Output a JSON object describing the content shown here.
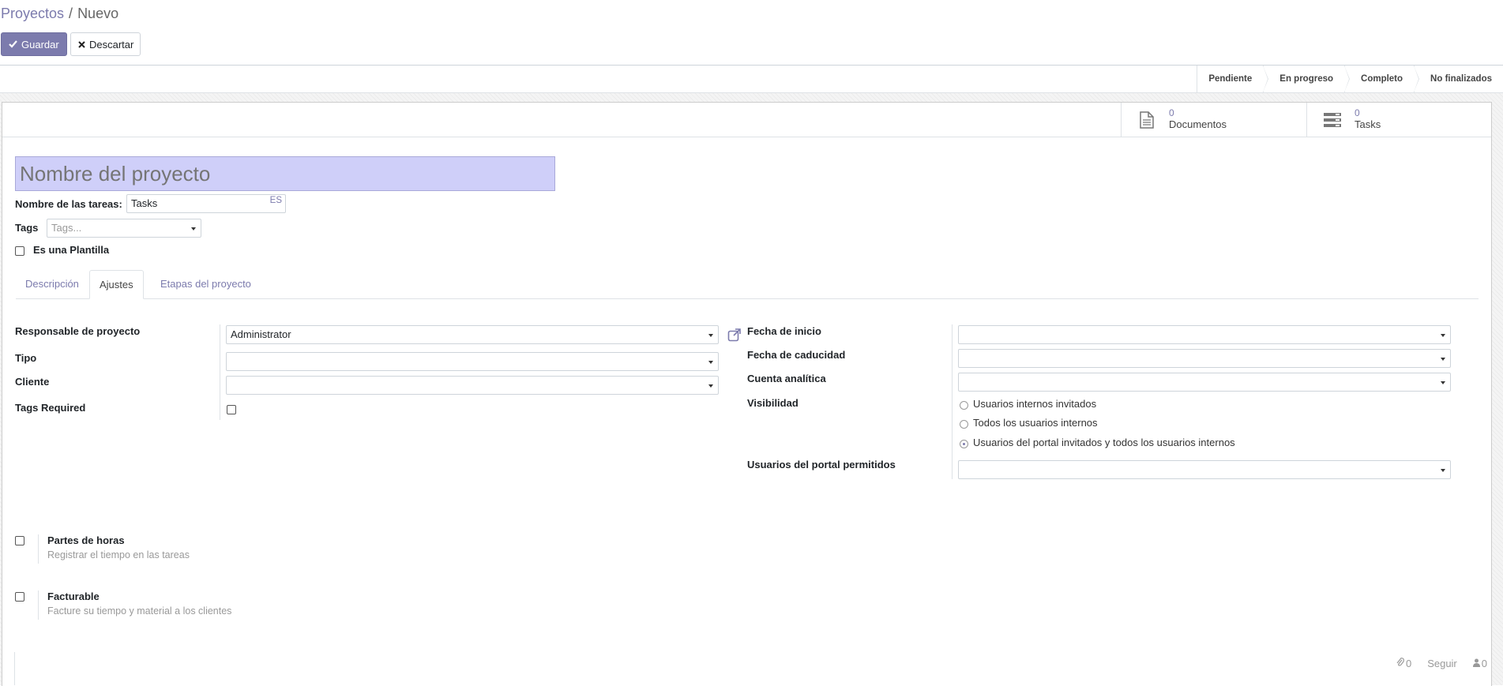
{
  "breadcrumb": {
    "parent": "Proyectos",
    "separator": "/",
    "current": "Nuevo"
  },
  "buttons": {
    "save": "Guardar",
    "discard": "Descartar"
  },
  "stages": [
    "Pendiente",
    "En progreso",
    "Completo",
    "No finalizados"
  ],
  "stat_buttons": [
    {
      "count": "0",
      "label": "Documentos",
      "icon": "document-icon"
    },
    {
      "count": "0",
      "label": "Tasks",
      "icon": "tasks-icon"
    }
  ],
  "form": {
    "name_placeholder": "Nombre del proyecto",
    "task_name_label": "Nombre de las tareas:",
    "task_name_value": "Tasks",
    "lang_badge": "ES",
    "tags_label": "Tags",
    "tags_placeholder": "Tags...",
    "template_label": "Es una Plantilla"
  },
  "tabs": [
    "Descripción",
    "Ajustes",
    "Etapas del proyecto"
  ],
  "settings": {
    "manager_label": "Responsable de proyecto",
    "manager_value": "Administrator",
    "type_label": "Tipo",
    "customer_label": "Cliente",
    "tags_required_label": "Tags Required",
    "start_label": "Fecha de inicio",
    "expiry_label": "Fecha de caducidad",
    "analytic_label": "Cuenta analítica",
    "visibility_label": "Visibilidad",
    "visibility_options": [
      "Usuarios internos invitados",
      "Todos los usuarios internos",
      "Usuarios del portal invitados y todos los usuarios internos"
    ],
    "visibility_selected": 2,
    "portal_users_label": "Usuarios del portal permitidos"
  },
  "options": [
    {
      "title": "Partes de horas",
      "desc": "Registrar el tiempo en las tareas"
    },
    {
      "title": "Facturable",
      "desc": "Facture su tiempo y material a los clientes"
    }
  ],
  "chatter": {
    "attachments": "0",
    "follow": "Seguir",
    "followers": "0"
  },
  "colors": {
    "accent": "#7c7bad",
    "title_bg": "#cfcff9"
  }
}
